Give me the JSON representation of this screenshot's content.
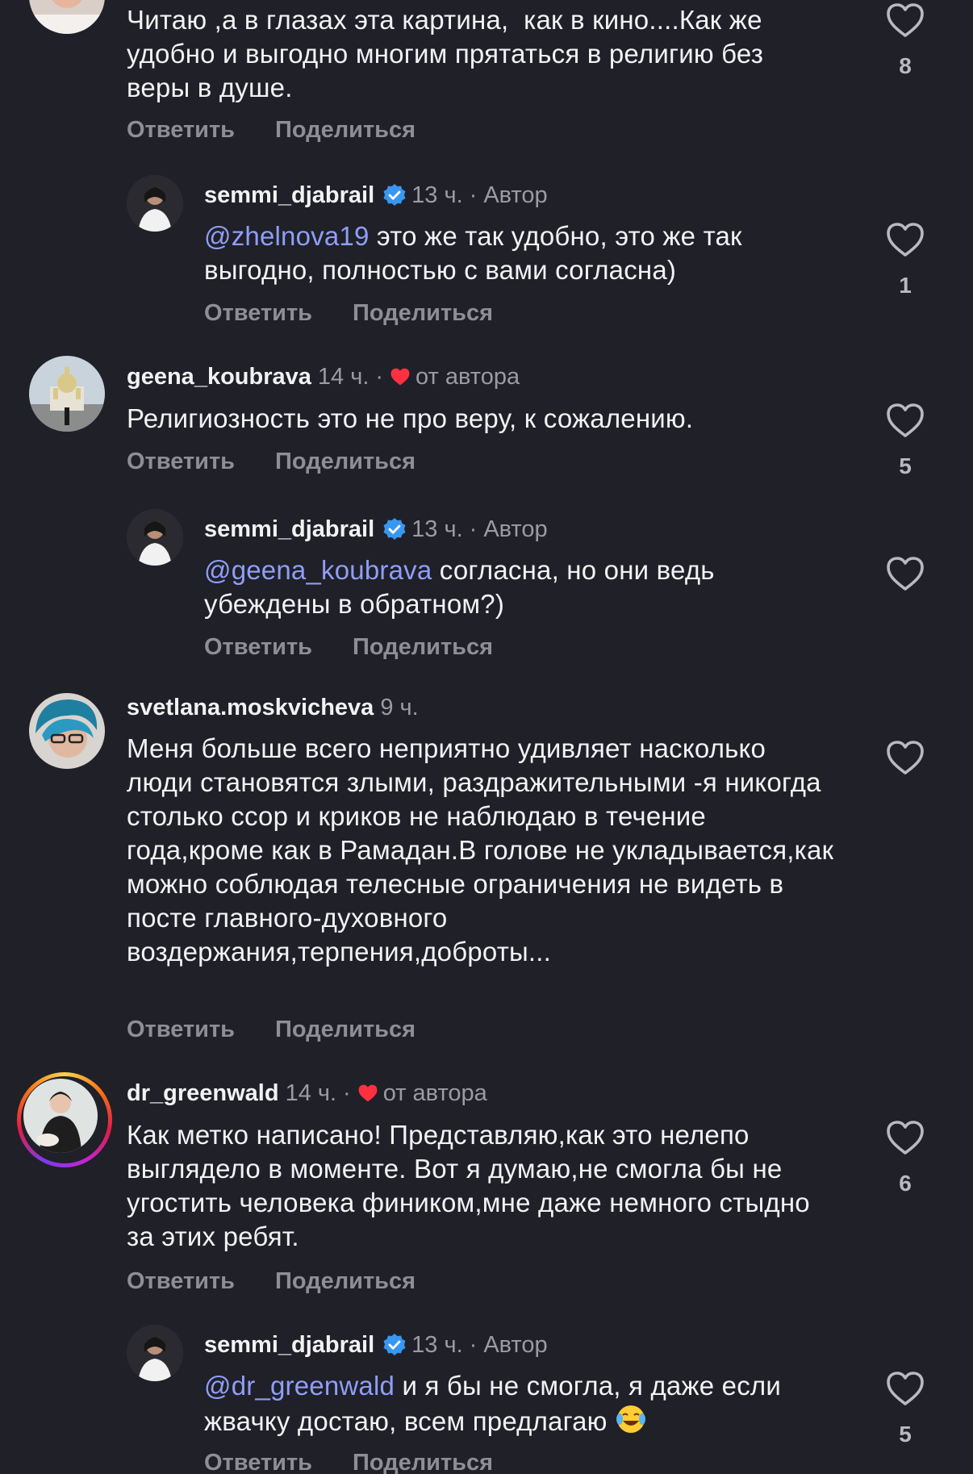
{
  "actions": {
    "reply": "Ответить",
    "share": "Поделиться"
  },
  "comments": [
    {
      "text": "Читаю ,а в глазах эта картина,  как в кино....Как же удобно и выгодно многим прятаться в религию без веры в душе.",
      "likes": "8"
    },
    {
      "user": "semmi_djabrail",
      "time": "13 ч.",
      "tag": "Автор",
      "mention": "@zhelnova19",
      "text": " это же так удобно, это же так выгодно, полностью с вами согласна)",
      "likes": "1"
    },
    {
      "user": "geena_koubrava",
      "time": "14 ч.",
      "tag": "от автора",
      "text": "Религиозность это не про веру, к сожалению.",
      "likes": "5"
    },
    {
      "user": "semmi_djabrail",
      "time": "13 ч.",
      "tag": "Автор",
      "mention": "@geena_koubrava",
      "text": " согласна, но они ведь убеждены в обратном?)",
      "likes": ""
    },
    {
      "user": "svetlana.moskvicheva",
      "time": "9 ч.",
      "text": "Меня больше всего неприятно удивляет насколько люди становятся злыми, раздражительными -я никогда столько ссор и криков не наблюдаю в течение года,кроме как в Рамадан.В голове не укладывается,как можно соблюдая телесные ограничения не видеть в посте главного-духовного воздержания,терпения,доброты...",
      "likes": ""
    },
    {
      "user": "dr_greenwald",
      "time": "14 ч.",
      "tag": "от автора",
      "text": "Как метко написано! Представляю,как это нелепо выглядело в моменте. Вот я думаю,не смогла бы не угостить человека фиником,мне даже немного стыдно за этих ребят.",
      "likes": "6"
    },
    {
      "user": "semmi_djabrail",
      "time": "13 ч.",
      "tag": "Автор",
      "mention": "@dr_greenwald",
      "text": " и я бы не смогла, я даже если жвачку достаю, всем предлагаю ",
      "emoji": "face-with-tears-of-joy",
      "likes": "5"
    }
  ],
  "colors": {
    "background": "#1f2028",
    "mention": "#8f9ef6",
    "verified": "#3897f0",
    "heart": "#ff3040"
  },
  "icons": {
    "like": "heart-outline-icon",
    "liked_by_author": "heart-filled-icon",
    "verified": "verified-badge-icon"
  }
}
